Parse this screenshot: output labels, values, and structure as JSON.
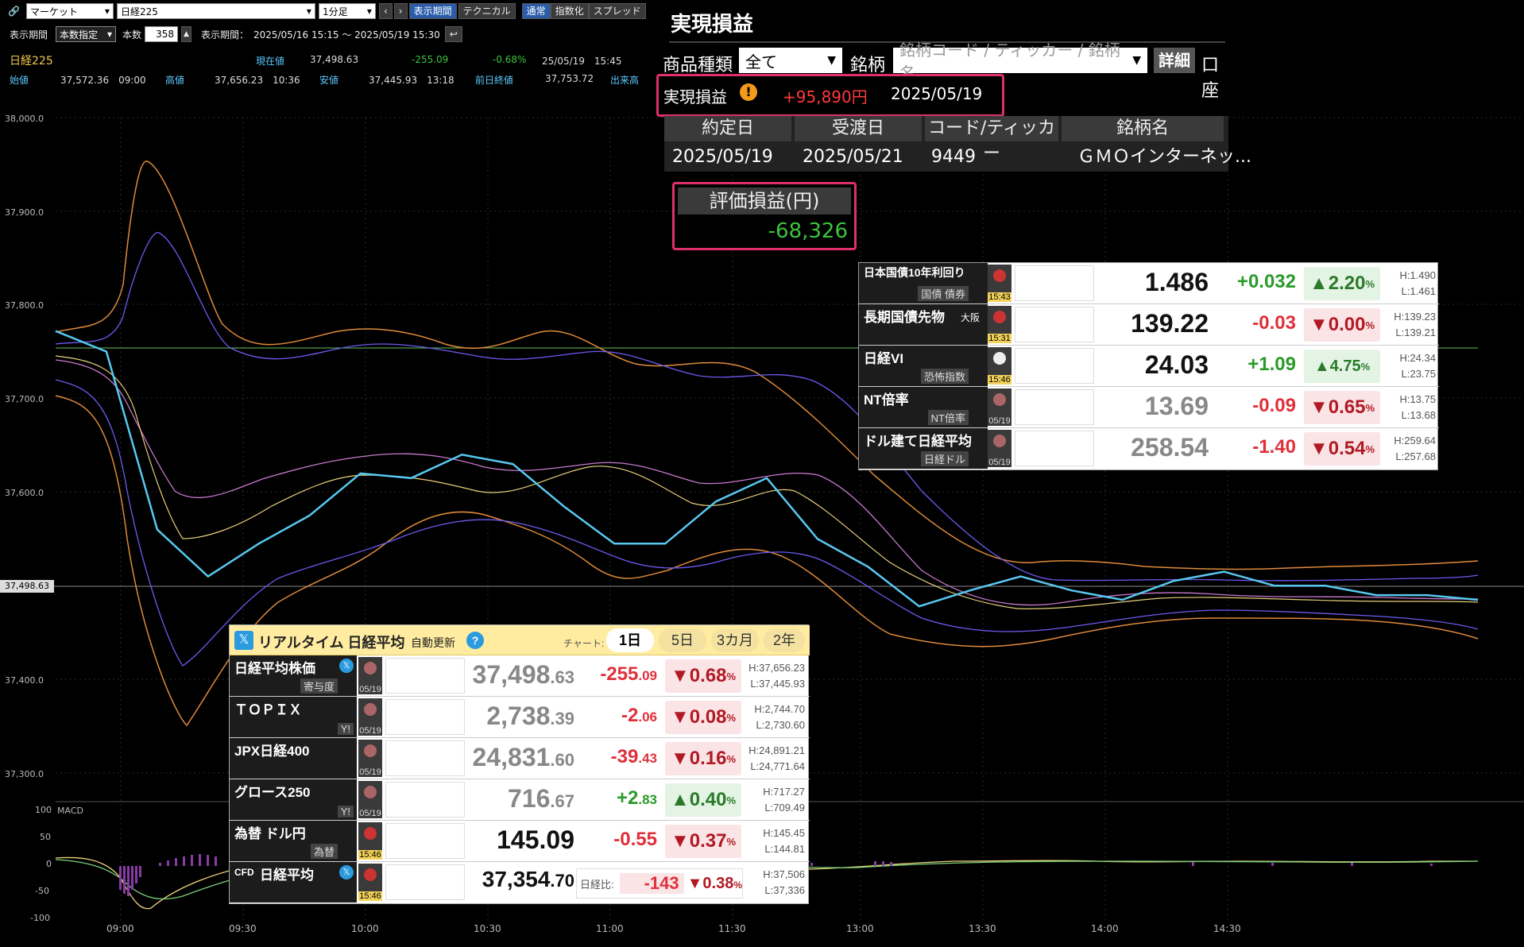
{
  "toolbar": {
    "market": "マーケット",
    "symbol": "日経225",
    "interval": "1分足",
    "btn_period": "表示期間",
    "btn_tech": "テクニカル",
    "btn_normal": "通常",
    "btn_index": "指数化",
    "btn_spread": "スプレッド",
    "period_label": "表示期間",
    "period_mode": "本数指定",
    "count_label": "本数",
    "count": "358",
    "range_label": "表示期間：",
    "range": "2025/05/16 15:15 ～ 2025/05/19 15:30"
  },
  "quote": {
    "name": "日経225",
    "now_label": "現在値",
    "now": "37,498.63",
    "chg": "-255.09",
    "pct": "-0.68%",
    "datetime": "25/05/19　15:45",
    "open_label": "始値",
    "open": "37,572.36　09:00",
    "high_label": "高値",
    "high": "37,656.23　10:36",
    "low_label": "安値",
    "low": "37,445.93　13:18",
    "prev_label": "前日終値",
    "prev": "37,753.72",
    "vol_label": "出来高"
  },
  "chart_data": {
    "type": "candlestick",
    "x": [
      "09:00",
      "09:30",
      "10:00",
      "10:30",
      "11:00",
      "11:30",
      "13:00",
      "13:30",
      "14:00",
      "14:30"
    ],
    "y_ticks": [
      "38,000.0",
      "37,900.0",
      "37,800.0",
      "37,700.0",
      "37,600.0",
      "37,500.0",
      "37,400.0",
      "37,300.0"
    ],
    "ylim": [
      37270,
      38020
    ],
    "last_price": "37,498.63",
    "prev_close": 37753.72,
    "close": [
      37772,
      37750,
      37560,
      37510,
      37545,
      37575,
      37620,
      37615,
      37640,
      37630,
      37585,
      37545,
      37545,
      37590,
      37615,
      37550,
      37520,
      37478,
      37495,
      37510,
      37495,
      37485,
      37505,
      37515,
      37500,
      37500,
      37490,
      37490,
      37485
    ],
    "macd_label": "MACD",
    "macd_ticks": [
      "100",
      "50",
      "0",
      "-50",
      "-100"
    ]
  },
  "realized": {
    "title": "実現損益",
    "type_label": "商品種類",
    "type_value": "全て",
    "symbol_label": "銘柄",
    "symbol_placeholder": "銘柄コード / ティッカー / 銘柄名",
    "detail_btn": "詳細",
    "account_label": "口座",
    "pl_label": "実現損益",
    "pl_value": "+95,890円",
    "pl_date": "2025/05/19",
    "headers": [
      "約定日",
      "受渡日",
      "コード/ティッカー",
      "銘柄名"
    ],
    "row": [
      "2025/05/19",
      "2025/05/21",
      "9449",
      "ＧＭＯインターネッ..."
    ],
    "eval_label": "評価損益(円)",
    "eval_value": "-68,326"
  },
  "markets": [
    {
      "name": "日本国債10年利回り",
      "sub": "国債 債券",
      "time": "15:43",
      "price": "1.486",
      "chg": "+0.032",
      "pct": "2.20",
      "dir": "up",
      "h": "H:1.490",
      "l": "L:1.461"
    },
    {
      "name": "長期国債先物",
      "tag": "大阪",
      "time": "15:31",
      "price": "139.22",
      "chg": "-0.03",
      "pct": "0.00",
      "dir": "dn",
      "h": "H:139.23",
      "l": "L:139.21"
    },
    {
      "name": "日経VI",
      "sub": "恐怖指数",
      "time": "15:46",
      "price": "24.03",
      "chg": "+1.09",
      "pct": "4.75",
      "dir": "up",
      "h": "H:24.34",
      "l": "L:23.75"
    },
    {
      "name": "NT倍率",
      "sub": "NT倍率",
      "time": "05/19",
      "price": "13.69",
      "chg": "-0.09",
      "pct": "0.65",
      "dir": "dn",
      "h": "H:13.75",
      "l": "L:13.68"
    },
    {
      "name": "ドル建て日経平均",
      "sub": "日経ドル",
      "time": "05/19",
      "price": "258.54",
      "chg": "-1.40",
      "pct": "0.54",
      "dir": "dn",
      "h": "H:259.64",
      "l": "L:257.68"
    }
  ],
  "realtime": {
    "title": "リアルタイム 日経平均",
    "auto": "自動更新",
    "chart_label": "チャート:",
    "tabs": [
      "1日",
      "5日",
      "3カ月",
      "2年"
    ],
    "rows": [
      {
        "name": "日経平均株価",
        "sub": "寄与度",
        "time": "05/19",
        "price_int": "37,498",
        "price_dec": ".63",
        "chg_int": "-255",
        "chg_dec": ".09",
        "pct": "0.68",
        "h": "H:37,656.23",
        "l": "L:37,445.93"
      },
      {
        "name": "ＴＯＰＩＸ",
        "sub": "Y!",
        "time": "05/19",
        "price_int": "2,738",
        "price_dec": ".39",
        "chg_int": "-2",
        "chg_dec": ".06",
        "pct": "0.08",
        "h": "H:2,744.70",
        "l": "L:2,730.60"
      },
      {
        "name": "JPX日経400",
        "time": "05/19",
        "price_int": "24,831",
        "price_dec": ".60",
        "chg_int": "-39",
        "chg_dec": ".43",
        "pct": "0.16",
        "h": "H:24,891.21",
        "l": "L:24,771.64"
      },
      {
        "name": "グロース250",
        "sub": "Y!",
        "time": "05/19",
        "price_int": "716",
        "price_dec": ".67",
        "chg_int": "+2",
        "chg_dec": ".83",
        "pct": "0.40",
        "h": "H:717.27",
        "l": "L:709.49"
      },
      {
        "name": "為替 ドル円",
        "sub": "為替",
        "time": "15:46",
        "price": "145.09",
        "chg": "-0.55",
        "pct": "0.37",
        "h": "H:145.45",
        "l": "L:144.81"
      },
      {
        "name": "日経平均",
        "tag": "CFD",
        "time": "15:46",
        "price_int": "37,354",
        "price_dec": ".70",
        "ratio_label": "日経比:",
        "ratio": "-143",
        "pct": "0.38",
        "h": "H:37,506",
        "l": "L:37,336"
      }
    ]
  }
}
